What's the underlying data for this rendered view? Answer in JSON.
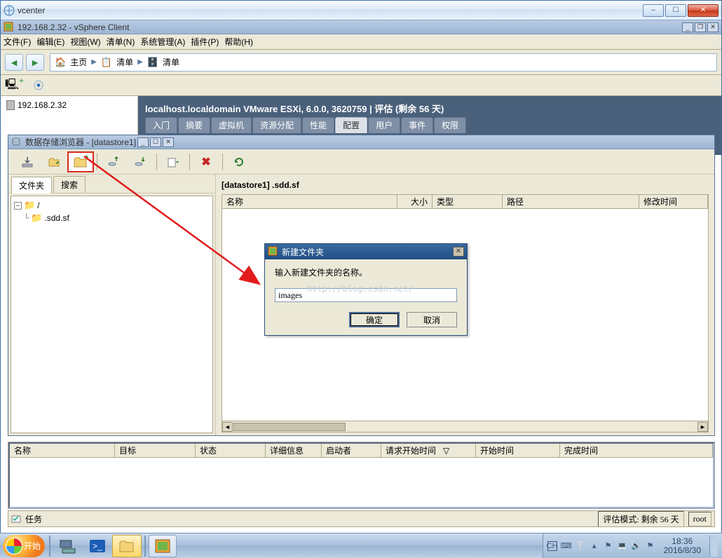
{
  "outer_window": {
    "title": "vcenter",
    "minimize": "–",
    "maximize": "☐",
    "close": "✕"
  },
  "vsphere_window": {
    "title": "192.168.2.32 - vSphere Client",
    "minimize": "_",
    "restore": "❐",
    "close": "✕"
  },
  "menu": {
    "file": "文件(F)",
    "edit": "编辑(E)",
    "view": "视图(W)",
    "inventory": "清单(N)",
    "admin": "系统管理(A)",
    "plugins": "插件(P)",
    "help": "帮助(H)"
  },
  "breadcrumb": {
    "home": "主页",
    "inventory": "清单",
    "inventory2": "清单"
  },
  "tree": {
    "server": "192.168.2.32"
  },
  "host": {
    "header": "localhost.localdomain VMware ESXi, 6.0.0, 3620759 | 评估 (剩余 56 天)",
    "tabs": {
      "getting_started": "入门",
      "summary": "摘要",
      "vms": "虚拟机",
      "resources": "资源分配",
      "performance": "性能",
      "config": "配置",
      "users": "用户",
      "events": "事件",
      "permissions": "权限"
    }
  },
  "datastore_browser": {
    "title": "数据存储浏览器 - [datastore1]",
    "tabs": {
      "folders": "文件夹",
      "search": "搜索"
    },
    "tree": {
      "root": "/",
      "child1": ".sdd.sf"
    },
    "path": "[datastore1] .sdd.sf",
    "columns": {
      "name": "名称",
      "size": "大小",
      "type": "类型",
      "path": "路径",
      "modified": "修改时间"
    }
  },
  "new_folder_dialog": {
    "title": "新建文件夹",
    "label": "输入新建文件夹的名称。",
    "value": "images",
    "ok": "确定",
    "cancel": "取消",
    "watermark": "http://blog.csdn.net/"
  },
  "task_pane": {
    "columns": {
      "name": "名称",
      "target": "目标",
      "status": "状态",
      "details": "详细信息",
      "initiator": "启动者",
      "reqstart": "请求开始时间",
      "start": "开始时间",
      "complete": "完成时间"
    }
  },
  "statusbar": {
    "tasks_tab": "任务",
    "eval": "评估模式: 剩余 56 天",
    "user": "root"
  },
  "taskbar": {
    "start": "开始",
    "lang": "CH",
    "time": "18:36",
    "date": "2016/8/30"
  }
}
